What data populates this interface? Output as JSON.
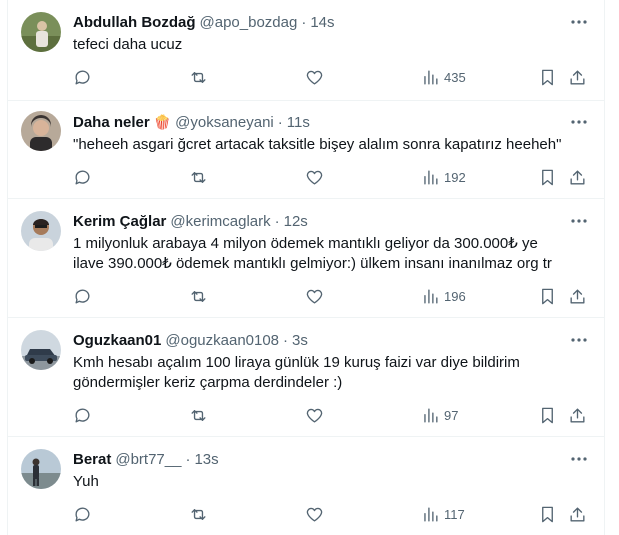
{
  "tweets": [
    {
      "name": "Abdullah Bozdağ",
      "emoji": "",
      "handle": "@apo_bozdag",
      "time": "14s",
      "text_lines": [
        "tefeci daha ucuz"
      ],
      "views": "435"
    },
    {
      "name": "Daha neler",
      "emoji": "🍿",
      "handle": "@yoksaneyani",
      "time": "11s",
      "text_lines": [
        "\"heheeh asgari ğcret artacak taksitle bişey alalım sonra kapatırız heeheh\""
      ],
      "views": "192"
    },
    {
      "name": "Kerim Çağlar",
      "emoji": "",
      "handle": "@kerimcaglark",
      "time": "12s",
      "text_lines": [
        "1 milyonluk arabaya 4 milyon ödemek mantıklı geliyor da 300.000₺ ye",
        "ilave 390.000₺ ödemek mantıklı gelmiyor:) ülkem insanı inanılmaz org tr"
      ],
      "views": "196"
    },
    {
      "name": "Oguzkaan01",
      "emoji": "",
      "handle": "@oguzkaan0108",
      "time": "3s",
      "text_lines": [
        "Kmh hesabı açalım 100 liraya günlük 19 kuruş faizi var diye bildirim",
        "göndermişler keriz çarpma derdindeler :)"
      ],
      "views": "97"
    },
    {
      "name": "Berat",
      "emoji": "",
      "handle": "@brt77__",
      "time": "13s",
      "text_lines": [
        "Yuh"
      ],
      "views": "117"
    }
  ],
  "separator": "·",
  "icons": {
    "more": "more-dots-icon",
    "reply": "reply-icon",
    "retweet": "retweet-icon",
    "like": "heart-icon",
    "views": "views-chart-icon",
    "bookmark": "bookmark-icon",
    "share": "share-icon"
  },
  "colors": {
    "text": "#0f1419",
    "secondary": "#536471",
    "border": "#eff3f4"
  }
}
